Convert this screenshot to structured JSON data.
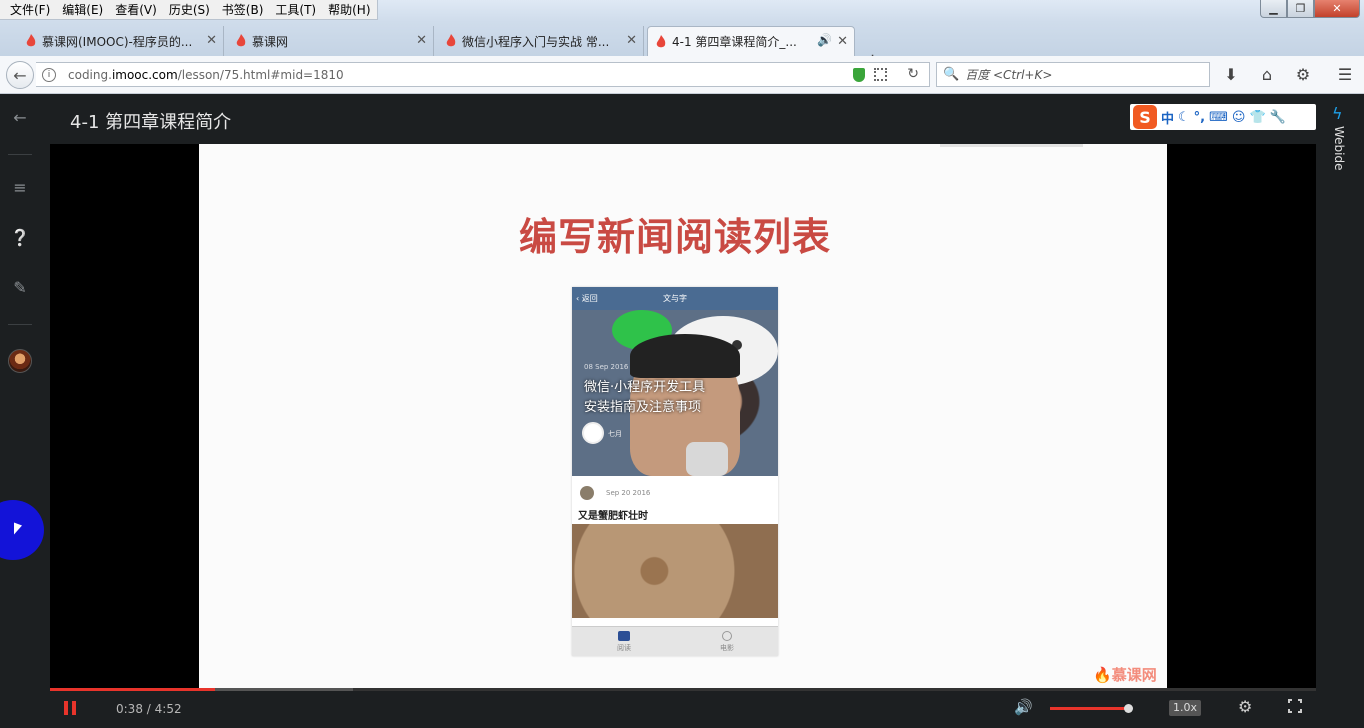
{
  "menubar": {
    "items": [
      "文件(F)",
      "编辑(E)",
      "查看(V)",
      "历史(S)",
      "书签(B)",
      "工具(T)",
      "帮助(H)"
    ]
  },
  "tabs": [
    {
      "label": "慕课网(IMOOC)-程序员的..."
    },
    {
      "label": "慕课网"
    },
    {
      "label": "微信小程序入门与实战 常..."
    },
    {
      "label": "4-1 第四章课程简介_..."
    }
  ],
  "navbar": {
    "url_prefix": "coding.",
    "url_domain": "imooc.com",
    "url_suffix": "/lesson/75.html#mid=1810",
    "search_placeholder": "百度 <Ctrl+K>"
  },
  "page": {
    "lesson_title": "4-1 第四章课程简介",
    "ime_char": "中",
    "right_panel_label": "Webide"
  },
  "slide": {
    "title": "编写新闻阅读列表",
    "logo": "慕课网",
    "phone": {
      "nav_back": "返回",
      "nav_title": "文与字",
      "hero_date": "08 Sep 2016",
      "hero_title_line1": "微信·小程序开发工具",
      "hero_title_line2": "安装指南及注意事项",
      "hero_author": "七月",
      "item_date": "Sep 20 2016",
      "item_title": "又是蟹肥虾壮时",
      "tab_read": "阅读",
      "tab_movie": "电影"
    }
  },
  "player": {
    "current_time": "0:38",
    "separator": "/",
    "duration": "4:52",
    "rate": "1.0x",
    "progress": 0.13,
    "volume": 0.95
  },
  "colors": {
    "accent": "#e8342b",
    "slide_title": "#c94a43",
    "ime_brand": "#f15a22"
  }
}
